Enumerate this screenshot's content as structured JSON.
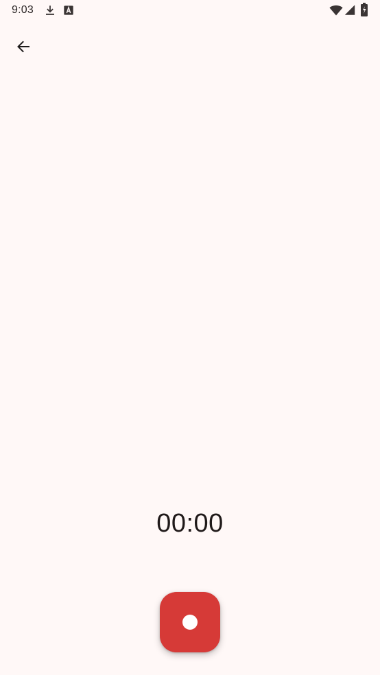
{
  "status_bar": {
    "time": "9:03",
    "icons": [
      "download-icon",
      "text-a-icon",
      "wifi-icon",
      "signal-icon",
      "battery-icon"
    ]
  },
  "toolbar": {
    "back_icon": "arrow-left-icon"
  },
  "recorder": {
    "elapsed": "00:00",
    "record_icon": "record-dot-icon"
  },
  "colors": {
    "background": "#FFF8F7",
    "record_button": "#D63A37",
    "text": "#201A1A"
  }
}
